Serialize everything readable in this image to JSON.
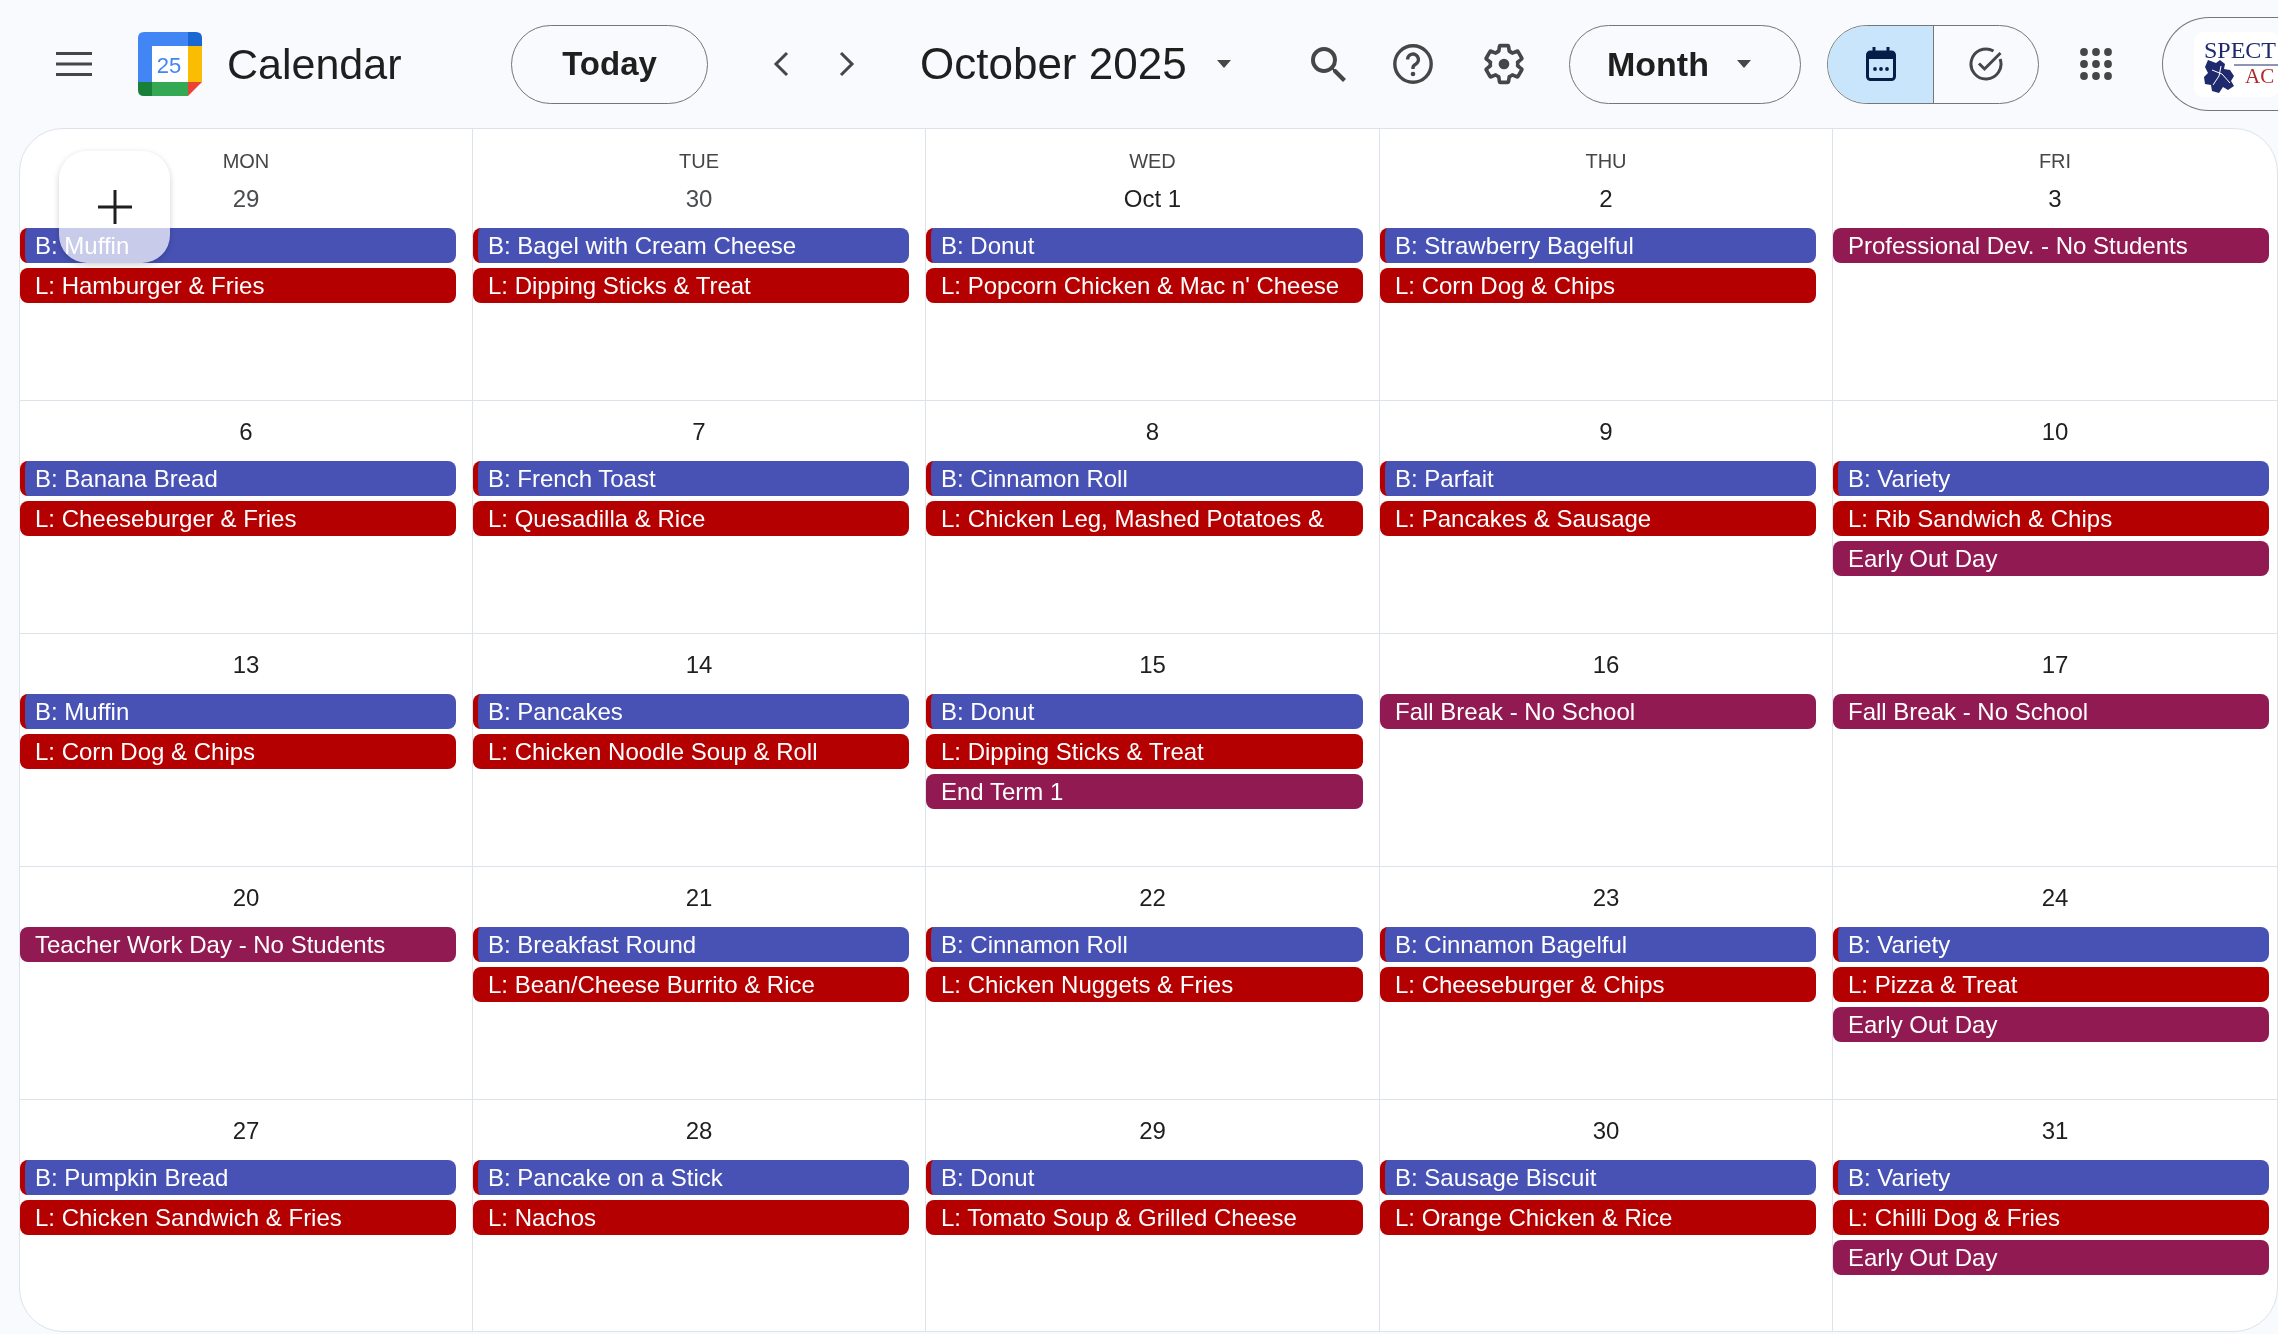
{
  "header": {
    "logo_date": "25",
    "app_title": "Calendar",
    "today_button": "Today",
    "period_title": "October 2025",
    "view_select": "Month",
    "view_toggle": [
      {
        "kind": "calendar",
        "selected": true
      },
      {
        "kind": "tasks",
        "selected": false
      }
    ],
    "account_logo": [
      "SPECT",
      "AC"
    ]
  },
  "weekdays": [
    "MON",
    "TUE",
    "WED",
    "THU",
    "FRI"
  ],
  "weeks": [
    {
      "days": [
        {
          "date": "29",
          "in_month": false,
          "events": [
            {
              "title": "B: Muffin",
              "color": "#4752b4",
              "stripe": {
                "color": "#b40000"
              }
            },
            {
              "title": "L: Hamburger & Fries",
              "color": "#b40000"
            }
          ]
        },
        {
          "date": "30",
          "in_month": false,
          "events": [
            {
              "title": "B: Bagel with Cream Cheese",
              "color": "#4752b4",
              "stripe": {
                "color": "#b40000"
              }
            },
            {
              "title": "L: Dipping Sticks & Treat",
              "color": "#b40000"
            }
          ]
        },
        {
          "date": "Oct 1",
          "in_month": true,
          "events": [
            {
              "title": "B: Donut",
              "color": "#4752b4",
              "stripe": {
                "color": "#b40000"
              }
            },
            {
              "title": "L: Popcorn Chicken & Mac n' Cheese",
              "color": "#b40000"
            }
          ]
        },
        {
          "date": "2",
          "in_month": true,
          "events": [
            {
              "title": "B: Strawberry Bagelful",
              "color": "#4752b4",
              "stripe": {
                "color": "#b40000"
              }
            },
            {
              "title": "L: Corn Dog & Chips",
              "color": "#b40000"
            }
          ]
        },
        {
          "date": "3",
          "in_month": true,
          "events": [
            {
              "title": "Professional Dev. - No Students",
              "color": "#921a52"
            }
          ]
        }
      ]
    },
    {
      "days": [
        {
          "date": "6",
          "in_month": true,
          "events": [
            {
              "title": "B: Banana Bread",
              "color": "#4752b4",
              "stripe": {
                "color": "#b40000"
              }
            },
            {
              "title": "L: Cheeseburger & Fries",
              "color": "#b40000"
            }
          ]
        },
        {
          "date": "7",
          "in_month": true,
          "events": [
            {
              "title": "B: French Toast",
              "color": "#4752b4",
              "stripe": {
                "color": "#b40000"
              }
            },
            {
              "title": "L: Quesadilla & Rice",
              "color": "#b40000"
            }
          ]
        },
        {
          "date": "8",
          "in_month": true,
          "events": [
            {
              "title": "B: Cinnamon Roll",
              "color": "#4752b4",
              "stripe": {
                "color": "#b40000"
              }
            },
            {
              "title": "L: Chicken Leg, Mashed Potatoes &",
              "color": "#b40000"
            }
          ]
        },
        {
          "date": "9",
          "in_month": true,
          "events": [
            {
              "title": "B: Parfait",
              "color": "#4752b4",
              "stripe": {
                "color": "#b40000"
              }
            },
            {
              "title": "L: Pancakes & Sausage",
              "color": "#b40000"
            }
          ]
        },
        {
          "date": "10",
          "in_month": true,
          "events": [
            {
              "title": "B: Variety",
              "color": "#4752b4",
              "stripe": {
                "color": "#b40000"
              }
            },
            {
              "title": "L: Rib Sandwich & Chips",
              "color": "#b40000"
            },
            {
              "title": "Early Out Day",
              "color": "#921a52"
            }
          ]
        }
      ]
    },
    {
      "days": [
        {
          "date": "13",
          "in_month": true,
          "events": [
            {
              "title": "B: Muffin",
              "color": "#4752b4",
              "stripe": {
                "color": "#b40000"
              }
            },
            {
              "title": "L: Corn Dog & Chips",
              "color": "#b40000"
            }
          ]
        },
        {
          "date": "14",
          "in_month": true,
          "events": [
            {
              "title": "B: Pancakes",
              "color": "#4752b4",
              "stripe": {
                "color": "#b40000"
              }
            },
            {
              "title": "L: Chicken Noodle Soup & Roll",
              "color": "#b40000"
            }
          ]
        },
        {
          "date": "15",
          "in_month": true,
          "events": [
            {
              "title": "B: Donut",
              "color": "#4752b4",
              "stripe": {
                "color": "#b40000"
              }
            },
            {
              "title": "L: Dipping Sticks & Treat",
              "color": "#b40000"
            },
            {
              "title": "End Term 1",
              "color": "#921a52"
            }
          ]
        },
        {
          "date": "16",
          "in_month": true,
          "events": [
            {
              "title": "Fall Break - No School",
              "color": "#921a52"
            }
          ]
        },
        {
          "date": "17",
          "in_month": true,
          "events": [
            {
              "title": "Fall Break - No School",
              "color": "#921a52"
            }
          ]
        }
      ]
    },
    {
      "days": [
        {
          "date": "20",
          "in_month": true,
          "events": [
            {
              "title": "Teacher Work Day - No Students",
              "color": "#921a52"
            }
          ]
        },
        {
          "date": "21",
          "in_month": true,
          "events": [
            {
              "title": "B: Breakfast Round",
              "color": "#4752b4",
              "stripe": {
                "color": "#b40000"
              }
            },
            {
              "title": "L: Bean/Cheese Burrito & Rice",
              "color": "#b40000"
            }
          ]
        },
        {
          "date": "22",
          "in_month": true,
          "events": [
            {
              "title": "B: Cinnamon Roll",
              "color": "#4752b4",
              "stripe": {
                "color": "#b40000"
              }
            },
            {
              "title": "L: Chicken Nuggets & Fries",
              "color": "#b40000"
            }
          ]
        },
        {
          "date": "23",
          "in_month": true,
          "events": [
            {
              "title": "B: Cinnamon Bagelful",
              "color": "#4752b4",
              "stripe": {
                "color": "#b40000"
              }
            },
            {
              "title": "L: Cheeseburger & Chips",
              "color": "#b40000"
            }
          ]
        },
        {
          "date": "24",
          "in_month": true,
          "events": [
            {
              "title": "B: Variety",
              "color": "#4752b4",
              "stripe": {
                "color": "#b40000"
              }
            },
            {
              "title": "L: Pizza & Treat",
              "color": "#b40000"
            },
            {
              "title": "Early Out Day",
              "color": "#921a52"
            }
          ]
        }
      ]
    },
    {
      "days": [
        {
          "date": "27",
          "in_month": true,
          "events": [
            {
              "title": "B: Pumpkin Bread",
              "color": "#4752b4",
              "stripe": {
                "color": "#b40000"
              }
            },
            {
              "title": "L: Chicken Sandwich & Fries",
              "color": "#b40000"
            }
          ]
        },
        {
          "date": "28",
          "in_month": true,
          "events": [
            {
              "title": "B: Pancake on a Stick",
              "color": "#4752b4",
              "stripe": {
                "color": "#b40000"
              }
            },
            {
              "title": "L: Nachos",
              "color": "#b40000"
            }
          ]
        },
        {
          "date": "29",
          "in_month": true,
          "events": [
            {
              "title": "B: Donut",
              "color": "#4752b4",
              "stripe": {
                "color": "#b40000"
              }
            },
            {
              "title": "L: Tomato Soup & Grilled Cheese",
              "color": "#b40000"
            }
          ]
        },
        {
          "date": "30",
          "in_month": true,
          "events": [
            {
              "title": "B: Sausage Biscuit",
              "color": "#4752b4",
              "stripe": {
                "color": "#b40000"
              }
            },
            {
              "title": "L: Orange Chicken & Rice",
              "color": "#b40000"
            }
          ]
        },
        {
          "date": "31",
          "in_month": true,
          "events": [
            {
              "title": "B: Variety",
              "color": "#4752b4",
              "stripe": {
                "color": "#b40000"
              }
            },
            {
              "title": "L: Chilli Dog & Fries",
              "color": "#b40000"
            },
            {
              "title": "Early Out Day",
              "color": "#921a52"
            }
          ]
        }
      ]
    }
  ]
}
